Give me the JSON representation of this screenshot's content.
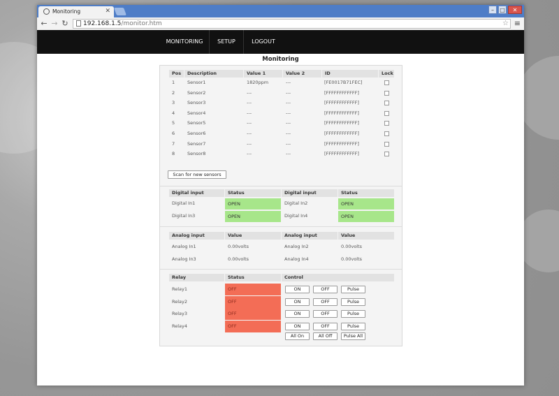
{
  "browser": {
    "tab_title": "Monitoring",
    "url_host": "192.168.1.5",
    "url_path": "/monitor.htm",
    "nav_icons": [
      "back-arrow-icon",
      "forward-arrow-icon",
      "reload-icon"
    ],
    "window_buttons": [
      "minimize",
      "maximize",
      "close"
    ]
  },
  "nav": {
    "items": [
      "MONITORING",
      "SETUP",
      "LOGOUT"
    ]
  },
  "page": {
    "title": "Monitoring"
  },
  "sensors": {
    "headers": [
      "Pos",
      "Description",
      "Value 1",
      "Value 2",
      "ID",
      "Lock"
    ],
    "rows": [
      {
        "pos": "1",
        "desc": "Sensor1",
        "v1": "1820ppm",
        "v2": "---",
        "id": "[FE0017B71FEC]"
      },
      {
        "pos": "2",
        "desc": "Sensor2",
        "v1": "---",
        "v2": "---",
        "id": "[FFFFFFFFFFFF]"
      },
      {
        "pos": "3",
        "desc": "Sensor3",
        "v1": "---",
        "v2": "---",
        "id": "[FFFFFFFFFFFF]"
      },
      {
        "pos": "4",
        "desc": "Sensor4",
        "v1": "---",
        "v2": "---",
        "id": "[FFFFFFFFFFFF]"
      },
      {
        "pos": "5",
        "desc": "Sensor5",
        "v1": "---",
        "v2": "---",
        "id": "[FFFFFFFFFFFF]"
      },
      {
        "pos": "6",
        "desc": "Sensor6",
        "v1": "---",
        "v2": "---",
        "id": "[FFFFFFFFFFFF]"
      },
      {
        "pos": "7",
        "desc": "Sensor7",
        "v1": "---",
        "v2": "---",
        "id": "[FFFFFFFFFFFF]"
      },
      {
        "pos": "8",
        "desc": "Sensor8",
        "v1": "---",
        "v2": "---",
        "id": "[FFFFFFFFFFFF]"
      }
    ],
    "scan_button": "Scan for new sensors"
  },
  "digital": {
    "headers": [
      "Digital input",
      "Status",
      "Digital input",
      "Status"
    ],
    "rows": [
      {
        "l_name": "Digital In1",
        "l_status": "OPEN",
        "r_name": "Digital In2",
        "r_status": "OPEN"
      },
      {
        "l_name": "Digital In3",
        "l_status": "OPEN",
        "r_name": "Digital In4",
        "r_status": "OPEN"
      }
    ],
    "status_color": "#a7e68a"
  },
  "analog": {
    "headers": [
      "Analog input",
      "Value",
      "Analog input",
      "Value"
    ],
    "rows": [
      {
        "l_name": "Analog In1",
        "l_value": "0.00volts",
        "r_name": "Analog In2",
        "r_value": "0.00volts"
      },
      {
        "l_name": "Analog In3",
        "l_value": "0.00volts",
        "r_name": "Analog In4",
        "r_value": "0.00volts"
      }
    ]
  },
  "relay": {
    "headers": [
      "Relay",
      "Status",
      "Control"
    ],
    "rows": [
      {
        "name": "Relay1",
        "status": "OFF"
      },
      {
        "name": "Relay2",
        "status": "OFF"
      },
      {
        "name": "Relay3",
        "status": "OFF"
      },
      {
        "name": "Relay4",
        "status": "OFF"
      }
    ],
    "on_label": "ON",
    "off_label": "OFF",
    "pulse_label": "Pulse",
    "all_on": "All On",
    "all_off": "All Off",
    "pulse_all": "Pulse All",
    "status_color": "#f36d56"
  }
}
